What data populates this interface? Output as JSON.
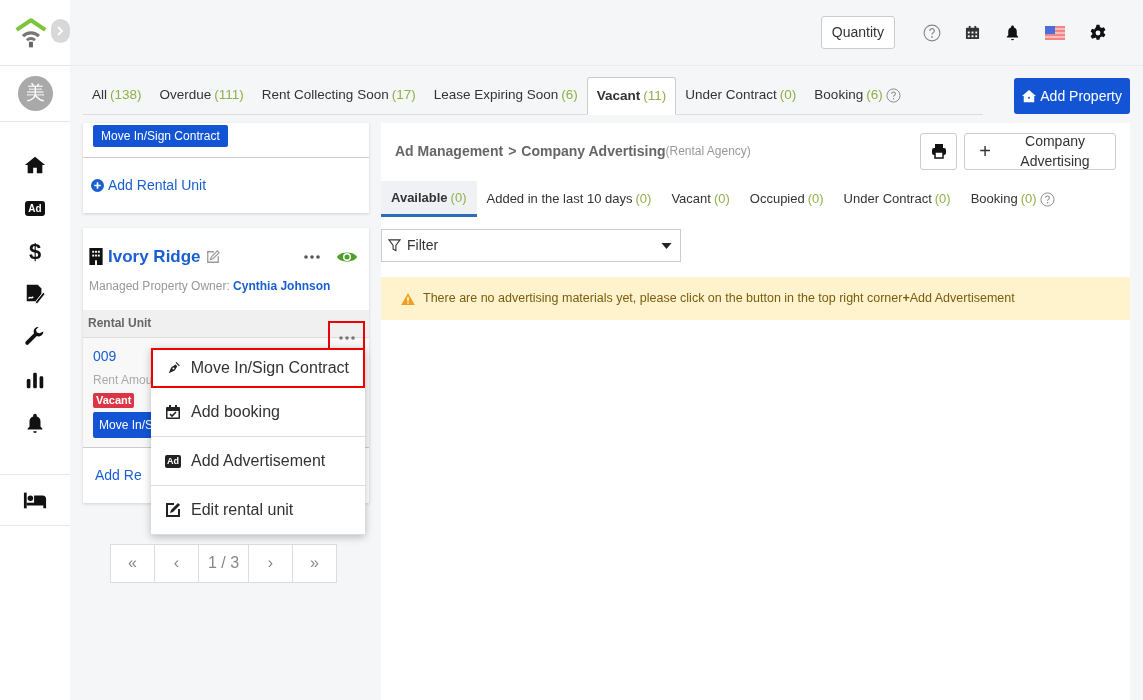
{
  "header": {
    "quantity_button": "Quantity"
  },
  "sidebar": {
    "avatar": "美",
    "items": [
      {
        "kind": "home"
      },
      {
        "kind": "ad",
        "text": "Ad"
      },
      {
        "kind": "dollar",
        "text": "$"
      },
      {
        "kind": "contract"
      },
      {
        "kind": "wrench"
      },
      {
        "kind": "chart"
      },
      {
        "kind": "bell"
      }
    ],
    "bottom_items": [
      {
        "kind": "bed"
      }
    ]
  },
  "tabs": [
    {
      "label": "All",
      "count": "(138)",
      "selected": false,
      "help": false
    },
    {
      "label": "Overdue",
      "count": "(111)",
      "selected": false,
      "help": false
    },
    {
      "label": "Rent Collecting Soon",
      "count": "(17)",
      "selected": false,
      "help": false
    },
    {
      "label": "Lease Expiring Soon",
      "count": "(6)",
      "selected": false,
      "help": false
    },
    {
      "label": "Vacant",
      "count": "(11)",
      "selected": true,
      "help": false
    },
    {
      "label": "Under Contract",
      "count": "(0)",
      "selected": false,
      "help": false
    },
    {
      "label": "Booking",
      "count": "(6)",
      "selected": false,
      "help": true
    }
  ],
  "add_property_button": "Add Property",
  "previous_card": {
    "button": "Move In/Sign Contract",
    "add_link": "Add Rental Unit"
  },
  "property_card": {
    "name": "Ivory Ridge",
    "owner_label": "Managed Property Owner:",
    "owner": "Cynthia Johnson",
    "section": "Rental Unit",
    "unit": {
      "number": "009",
      "rent": "Rent Amou",
      "status": "Vacant",
      "button": "Move In/S"
    },
    "add_link": "Add Re"
  },
  "menu": {
    "items": [
      {
        "kind": "sign",
        "label": "Move In/Sign Contract",
        "highlighted": true
      },
      {
        "kind": "booking",
        "label": "Add booking",
        "highlighted": false
      },
      {
        "kind": "ad",
        "label": "Add Advertisement",
        "icon_text": "Ad",
        "highlighted": false
      },
      {
        "kind": "edit",
        "label": "Edit rental unit",
        "highlighted": false
      }
    ]
  },
  "pagination": [
    "«",
    "‹",
    "1 / 3",
    "›",
    "»"
  ],
  "ad_panel": {
    "breadcrumb": [
      "Ad Management",
      ">",
      "Company Advertising"
    ],
    "breadcrumb_note": "(Rental Agency)",
    "add_button": {
      "icon": "+",
      "label": "Company Advertising"
    },
    "tabs": [
      {
        "label": "Available",
        "count": "(0)",
        "selected": true,
        "help": false
      },
      {
        "label": "Added in the last 10 days",
        "count": "(0)",
        "selected": false,
        "help": false
      },
      {
        "label": "Vacant",
        "count": "(0)",
        "selected": false,
        "help": false
      },
      {
        "label": "Occupied",
        "count": "(0)",
        "selected": false,
        "help": false
      },
      {
        "label": "Under Contract",
        "count": "(0)",
        "selected": false,
        "help": false
      },
      {
        "label": "Booking",
        "count": "(0)",
        "selected": false,
        "help": true
      }
    ],
    "filter": "Filter",
    "alert": "There are no advertising materials yet, please click on the button in the top right corner**+**Add Advertisement"
  }
}
